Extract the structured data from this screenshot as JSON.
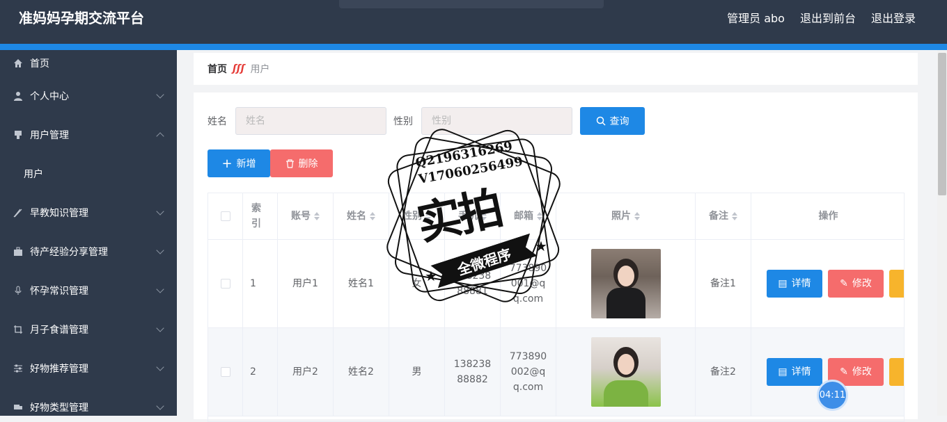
{
  "app": {
    "title": "准妈妈孕期交流平台"
  },
  "header": {
    "admin_label": "管理员 abo",
    "to_front": "退出到前台",
    "logout": "退出登录"
  },
  "sidebar": {
    "items": [
      {
        "label": "首页",
        "icon": "home-icon"
      },
      {
        "label": "个人中心",
        "icon": "user-icon"
      },
      {
        "label": "用户管理",
        "icon": "tablet-icon"
      },
      {
        "label": "用户",
        "icon": ""
      },
      {
        "label": "早教知识管理",
        "icon": "pen-icon"
      },
      {
        "label": "待产经验分享管理",
        "icon": "briefcase-icon"
      },
      {
        "label": "怀孕常识管理",
        "icon": "mic-icon"
      },
      {
        "label": "月子食谱管理",
        "icon": "crop-icon"
      },
      {
        "label": "好物推荐管理",
        "icon": "sliders-icon"
      },
      {
        "label": "好物类型管理",
        "icon": "truck-icon"
      }
    ]
  },
  "breadcrumb": {
    "home": "首页",
    "current": "用户"
  },
  "filters": {
    "name_label": "姓名",
    "name_placeholder": "姓名",
    "sex_label": "性别",
    "sex_placeholder": "性别",
    "query_button": "查询"
  },
  "actions": {
    "add": "新增",
    "delete": "删除"
  },
  "table": {
    "headers": {
      "index": "索引",
      "account": "账号",
      "name": "姓名",
      "sex": "性别",
      "phone": "手机",
      "email": "邮箱",
      "photo": "照片",
      "note": "备注",
      "ops": "操作"
    },
    "rows": [
      {
        "index": "1",
        "account": "用户1",
        "name": "姓名1",
        "sex": "女",
        "phone": "13823888881",
        "email": "773890001@qq.com",
        "note": "备注1"
      },
      {
        "index": "2",
        "account": "用户2",
        "name": "姓名2",
        "sex": "男",
        "phone": "13823888882",
        "email": "773890002@qq.com",
        "note": "备注2"
      }
    ],
    "detail_btn": "详情",
    "edit_btn": "修改"
  },
  "overlay": {
    "timer": "04:11",
    "stamp_q": "Q2196316269",
    "stamp_v": "V17060256499",
    "stamp_big": "实拍",
    "stamp_ribbon": "全微程序"
  }
}
